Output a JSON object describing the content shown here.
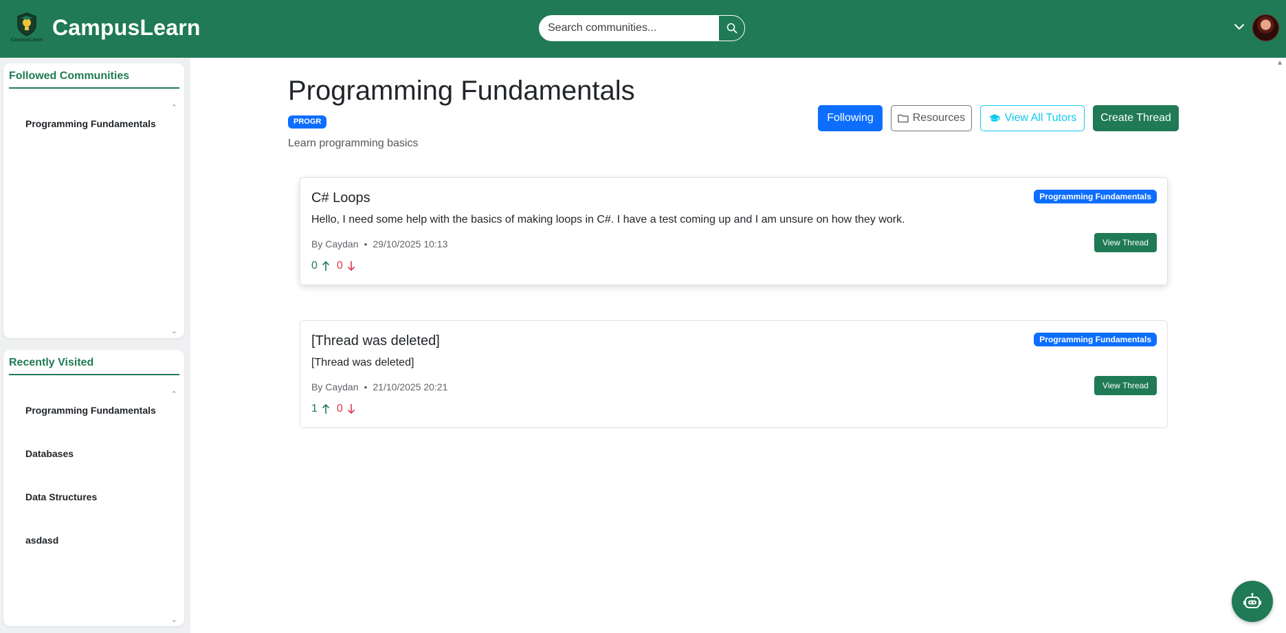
{
  "header": {
    "brand": "CampusLearn",
    "logo_text": "CampusLearn",
    "search_placeholder": "Search communities..."
  },
  "sidebar": {
    "followed_title": "Followed Communities",
    "followed_items": [
      "Programming Fundamentals"
    ],
    "recent_title": "Recently Visited",
    "recent_items": [
      "Programming Fundamentals",
      "Databases",
      "Data Structures",
      "asdasd"
    ]
  },
  "community": {
    "title": "Programming Fundamentals",
    "code": "PROGR",
    "description": "Learn programming basics"
  },
  "actions": {
    "following": "Following",
    "resources": "Resources",
    "tutors": "View All Tutors",
    "create": "Create Thread"
  },
  "threads": [
    {
      "title": "C# Loops",
      "tag": "Programming Fundamentals",
      "body": "Hello, I need some help with the basics of making loops in C#. I have a test coming up and I am unsure on how they work.",
      "author": "By Caydan",
      "date": "29/10/2025 10:13",
      "upvotes": "0",
      "downvotes": "0",
      "view_label": "View Thread"
    },
    {
      "title": "[Thread was deleted]",
      "tag": "Programming Fundamentals",
      "body": "[Thread was deleted]",
      "author": "By Caydan",
      "date": "21/10/2025 20:21",
      "upvotes": "1",
      "downvotes": "0",
      "view_label": "View Thread"
    }
  ],
  "colors": {
    "brand_green": "#1f7a55",
    "primary_blue": "#0d6efd",
    "info_cyan": "#0dcaf0",
    "danger_red": "#dc3545"
  },
  "icons": {
    "search": "search-icon",
    "chevron": "chevron-down-icon",
    "folder": "folder-icon",
    "graduation": "graduation-cap-icon",
    "up": "arrow-up-icon",
    "down": "arrow-down-icon",
    "bot": "robot-icon"
  }
}
